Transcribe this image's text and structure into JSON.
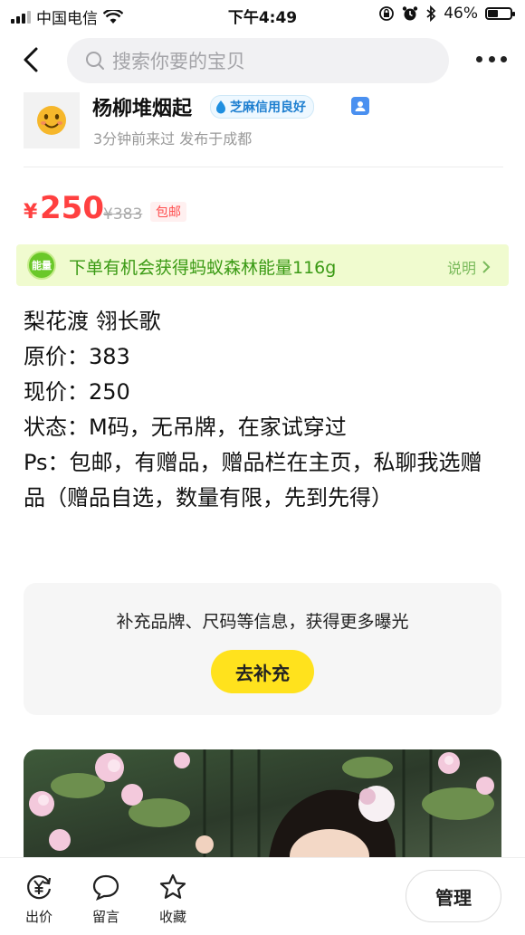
{
  "status_bar": {
    "carrier": "中国电信",
    "time": "下午4:49",
    "battery": "46%",
    "battery_level": 0.46
  },
  "nav": {
    "search_placeholder": "搜索你要的宝贝"
  },
  "seller": {
    "name": "杨柳堆烟起",
    "credit_badge": "芝麻信用良好",
    "meta": "3分钟前来过 发布于成都"
  },
  "price": {
    "currency": "¥",
    "value": "250",
    "original": "¥383",
    "shipping_tag": "包邮"
  },
  "energy_banner": {
    "icon_text": "能量",
    "text": "下单有机会获得蚂蚁森林能量116g",
    "help": "说明"
  },
  "description": {
    "lines": [
      "梨花渡 翎长歌",
      "原价：383",
      "现价：250",
      "状态：M码，无吊牌，在家试穿过",
      "Ps：包邮，有赠品，赠品栏在主页，私聊我选赠品（赠品自选，数量有限，先到先得）"
    ]
  },
  "supplement": {
    "text": "补充品牌、尺码等信息，获得更多曝光",
    "button": "去补充"
  },
  "bottom_bar": {
    "offer": "出价",
    "comment": "留言",
    "favorite": "收藏",
    "manage": "管理"
  }
}
